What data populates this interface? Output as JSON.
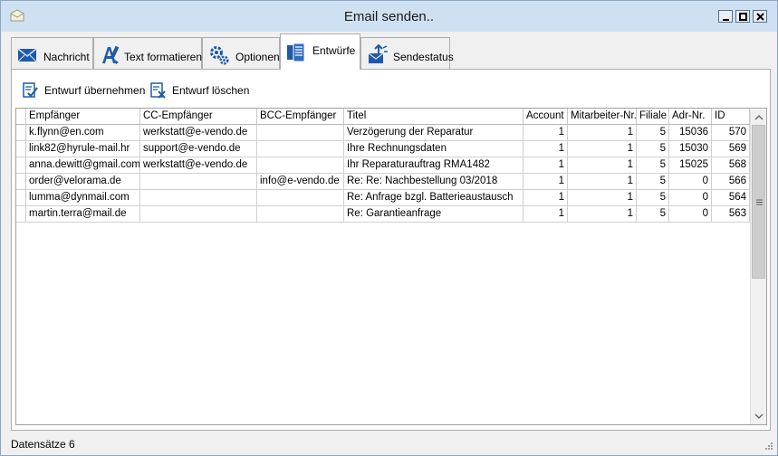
{
  "window": {
    "title": "Email senden.."
  },
  "tabs": [
    {
      "label": "Nachricht",
      "icon": "envelope-icon"
    },
    {
      "label": "Text formatieren",
      "icon": "format-text-icon"
    },
    {
      "label": "Optionen",
      "icon": "gears-icon"
    },
    {
      "label": "Entwürfe",
      "icon": "drafts-icon",
      "active": true
    },
    {
      "label": "Sendestatus",
      "icon": "send-status-icon"
    }
  ],
  "toolbar": {
    "apply_label": "Entwurf übernehmen",
    "delete_label": "Entwurf löschen"
  },
  "table": {
    "columns": [
      "Empfänger",
      "CC-Empfänger",
      "BCC-Empfänger",
      "Titel",
      "Account",
      "Mitarbeiter-Nr.",
      "Filiale",
      "Adr-Nr.",
      "ID"
    ],
    "rows": [
      [
        "k.flynn@en.com",
        "werkstatt@e-vendo.de",
        "",
        "Verzögerung der Reparatur",
        "1",
        "1",
        "5",
        "15036",
        "570"
      ],
      [
        "link82@hyrule-mail.hr",
        "support@e-vendo.de",
        "",
        "Ihre Rechnungsdaten",
        "1",
        "1",
        "5",
        "15030",
        "569"
      ],
      [
        "anna.dewitt@gmail.com",
        "werkstatt@e-vendo.de",
        "",
        "Ihr Reparaturauftrag RMA1482",
        "1",
        "1",
        "5",
        "15025",
        "568"
      ],
      [
        "order@velorama.de",
        "",
        "info@e-vendo.de",
        "Re: Re: Nachbestellung 03/2018",
        "1",
        "1",
        "5",
        "0",
        "566"
      ],
      [
        "lumma@dynmail.com",
        "",
        "",
        "Re: Anfrage bzgl. Batterieaustausch",
        "1",
        "1",
        "5",
        "0",
        "564"
      ],
      [
        "martin.terra@mail.de",
        "",
        "",
        "Re: Garantieanfrage",
        "1",
        "1",
        "5",
        "0",
        "563"
      ]
    ]
  },
  "status": {
    "records": "Datensätze 6"
  },
  "colors": {
    "titlebar": "#cfe0f2",
    "accent_blue": "#1f5aa8"
  }
}
